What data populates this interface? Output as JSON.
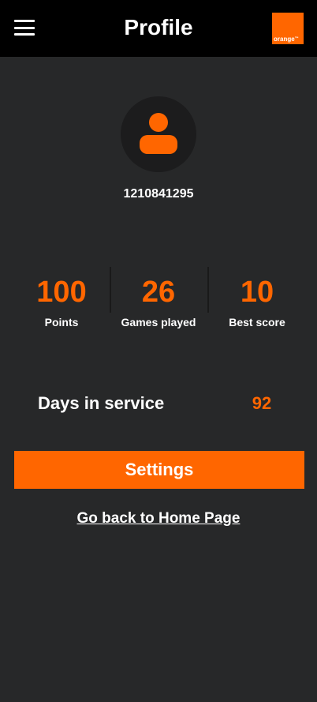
{
  "header": {
    "title": "Profile",
    "logo_text": "orange",
    "logo_mark": "™"
  },
  "profile": {
    "user_id": "1210841295"
  },
  "stats": [
    {
      "value": "100",
      "label": "Points"
    },
    {
      "value": "26",
      "label": "Games played"
    },
    {
      "value": "10",
      "label": "Best score"
    }
  ],
  "service": {
    "label": "Days in service",
    "value": "92"
  },
  "actions": {
    "settings_label": "Settings",
    "home_link_label": "Go back to Home Page"
  },
  "colors": {
    "accent": "#ff6600",
    "background": "#272829",
    "header": "#000000",
    "avatar_bg": "#1c1c1d"
  },
  "icons": {
    "menu": "hamburger-menu-icon",
    "avatar": "user-silhouette-icon"
  }
}
